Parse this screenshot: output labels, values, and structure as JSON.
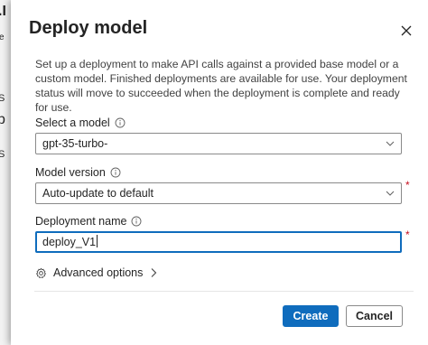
{
  "background": {
    "fragments": [
      ".I",
      "e",
      "S",
      "p",
      "S"
    ]
  },
  "dialog": {
    "title": "Deploy model",
    "description": "Set up a deployment to make API calls against a provided base model or a custom model. Finished deployments are available for use. Your deployment status will move to succeeded when the deployment is complete and ready for use.",
    "model": {
      "label": "Select a model",
      "value": "gpt-35-turbo-",
      "icon": "chevron-down-icon"
    },
    "version": {
      "label": "Model version",
      "value": "Auto-update to default",
      "required_marker": "*"
    },
    "deployment_name": {
      "label": "Deployment name",
      "value": "deploy_V1",
      "required_marker": "*"
    },
    "advanced_label": "Advanced options",
    "buttons": {
      "create": "Create",
      "cancel": "Cancel"
    }
  },
  "colors": {
    "accent": "#0f6cbd",
    "required": "#c50f1f",
    "overlay": "#8a8a8a"
  }
}
